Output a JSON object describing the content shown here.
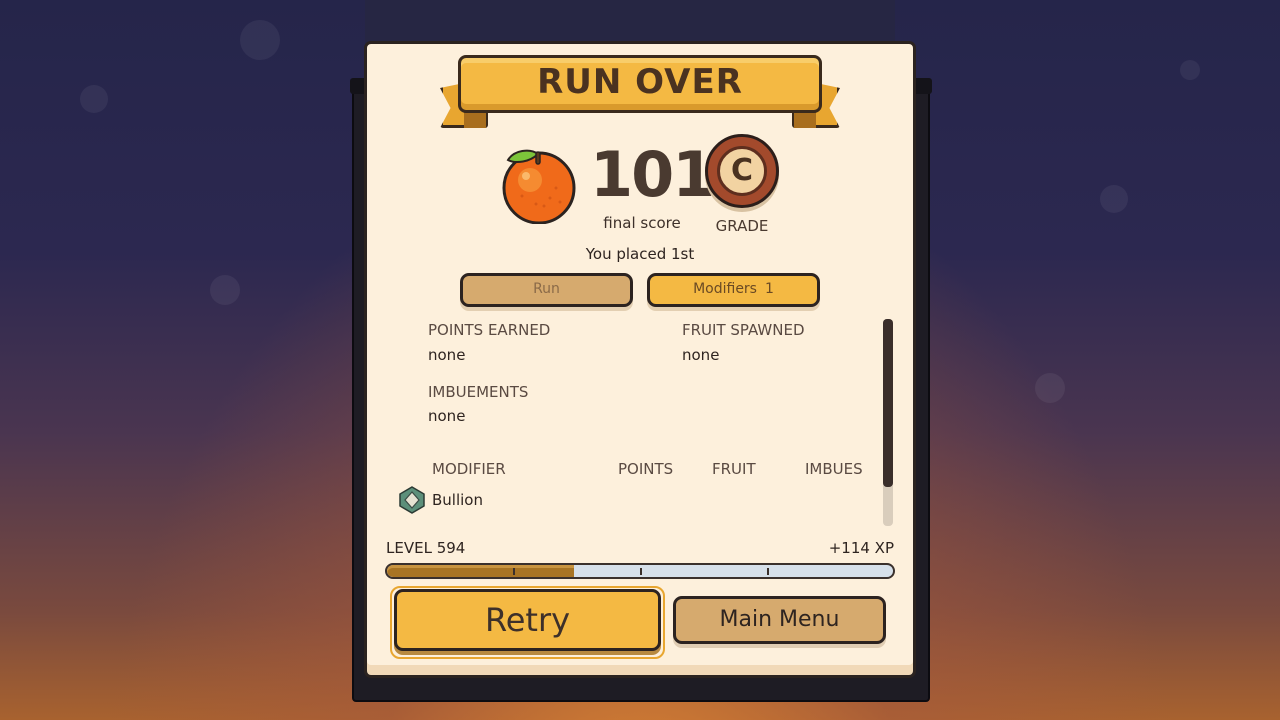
{
  "title": "RUN OVER",
  "score": {
    "value": "101",
    "label": "final score",
    "fruit_icon": "orange-icon"
  },
  "grade": {
    "letter": "C",
    "label": "GRADE",
    "badge_color": "#a34a2c"
  },
  "placement": "You placed 1st",
  "tabs": [
    {
      "label": "Run",
      "count": ""
    },
    {
      "label": "Modifiers",
      "count": "1"
    }
  ],
  "stats": {
    "points_earned": {
      "label": "POINTS EARNED",
      "value": "none"
    },
    "fruit_spawned": {
      "label": "FRUIT SPAWNED",
      "value": "none"
    },
    "imbuements": {
      "label": "IMBUEMENTS",
      "value": "none"
    }
  },
  "modifier_table": {
    "headers": [
      "MODIFIER",
      "POINTS",
      "FRUIT",
      "IMBUES"
    ],
    "rows": [
      {
        "icon": "bullion-icon",
        "name": "Bullion",
        "points": "",
        "fruit": "",
        "imbues": ""
      }
    ]
  },
  "progress": {
    "level_text": "LEVEL 594",
    "xp_text": "+114 XP",
    "fill_fraction": 0.37
  },
  "buttons": {
    "retry": "Retry",
    "main_menu": "Main Menu"
  },
  "colors": {
    "panel": "#fdf0dc",
    "accent_gold": "#f4b943",
    "tan": "#d6aa6e",
    "text_dark": "#2e2420"
  }
}
